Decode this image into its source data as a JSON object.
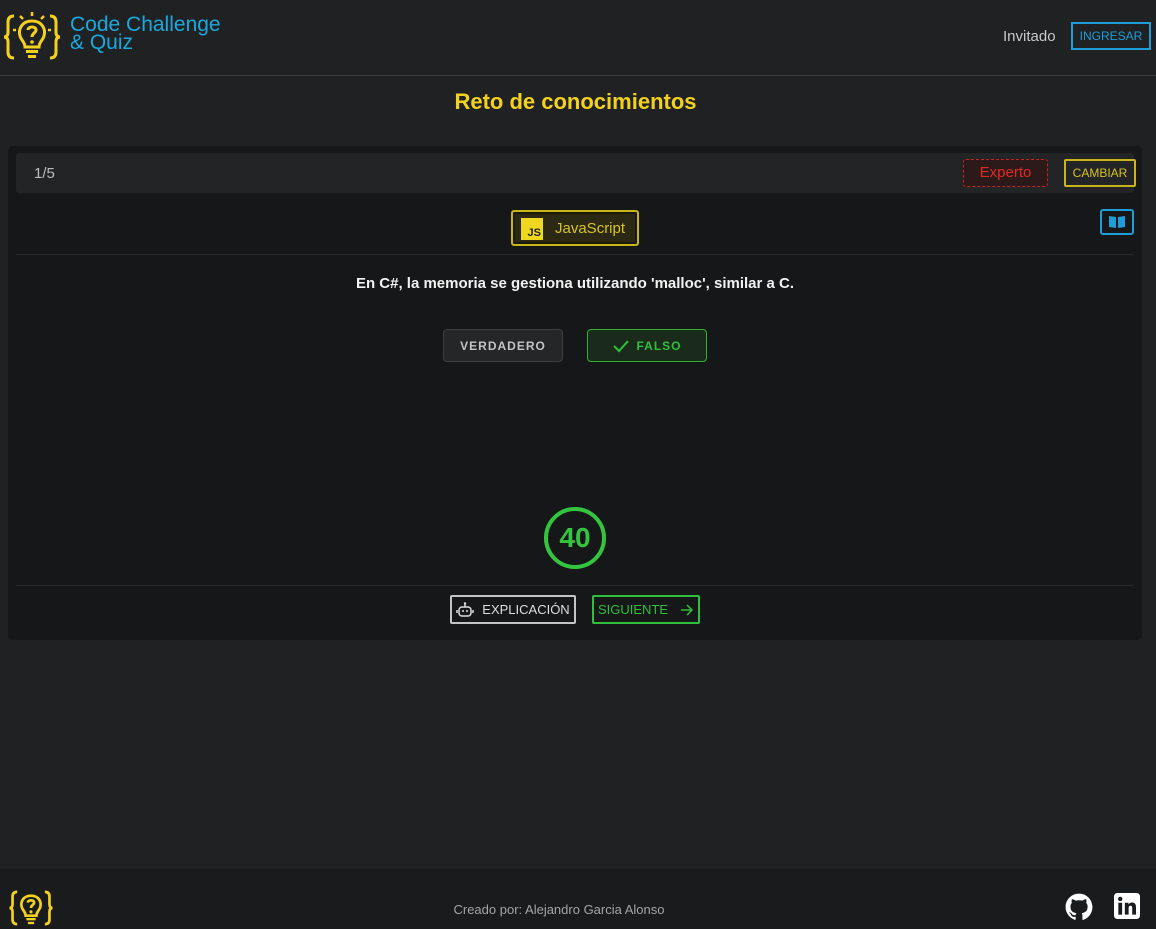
{
  "app": {
    "title_line1": "Code Challenge",
    "title_line2": "& Quiz",
    "logo_icon": "lightbulb-question-icon"
  },
  "header": {
    "user_label": "Invitado",
    "login_label": "INGRESAR"
  },
  "page": {
    "title": "Reto de conocimientos"
  },
  "quiz": {
    "counter": "1/5",
    "level": "Experto",
    "change_label": "CAMBIAR",
    "language": "JavaScript",
    "language_icon_text": "JS",
    "question": "En C#, la memoria se gestiona utilizando 'malloc', similar a C.",
    "answers": {
      "true_label": "VERDADERO",
      "false_label": "FALSO",
      "selected": "FALSO"
    },
    "timer": "40",
    "explain_label": "EXPLICACIÓN",
    "next_label": "SIGUIENTE"
  },
  "footer": {
    "credit": "Creado por: Alejandro Garcia Alonso",
    "icons": [
      "github-icon",
      "linkedin-icon"
    ]
  },
  "colors": {
    "accent_yellow": "#f4d21c",
    "accent_blue": "#19a9e0",
    "accent_green": "#2fbf3a",
    "accent_red": "#de2a23",
    "background": "#1f2122"
  }
}
